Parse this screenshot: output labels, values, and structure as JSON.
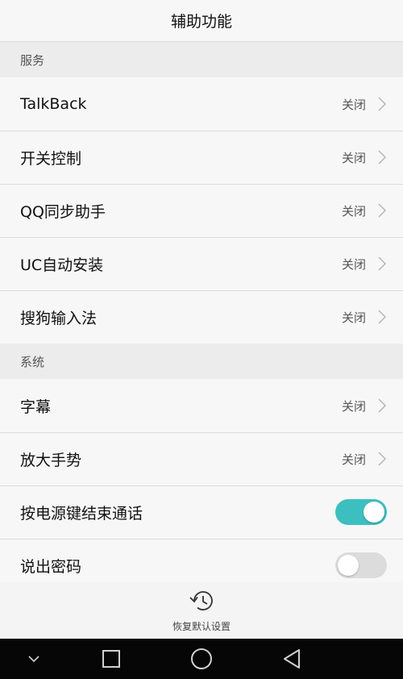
{
  "title": "辅助功能",
  "sections": [
    {
      "header": "服务",
      "items": [
        {
          "label": "TalkBack",
          "value": "关闭"
        },
        {
          "label": "开关控制",
          "value": "关闭"
        },
        {
          "label": "QQ同步助手",
          "value": "关闭"
        },
        {
          "label": "UC自动安装",
          "value": "关闭"
        },
        {
          "label": "搜狗输入法",
          "value": "关闭"
        }
      ]
    },
    {
      "header": "系统",
      "items": [
        {
          "label": "字幕",
          "value": "关闭"
        },
        {
          "label": "放大手势",
          "value": "关闭"
        }
      ],
      "toggles": [
        {
          "label": "按电源键结束通话",
          "state": "on"
        },
        {
          "label": "说出密码",
          "state": "off"
        }
      ]
    }
  ],
  "restore_label": "恢复默认设置",
  "colors": {
    "toggle_on": "#3dbfbf",
    "toggle_off": "#dcdcdc",
    "navbar": "#060606"
  },
  "icons": {
    "chevron": "chevron-right-icon",
    "restore": "history-icon",
    "nav": [
      "chevron-down-icon",
      "square-icon",
      "circle-icon",
      "triangle-left-icon"
    ]
  }
}
